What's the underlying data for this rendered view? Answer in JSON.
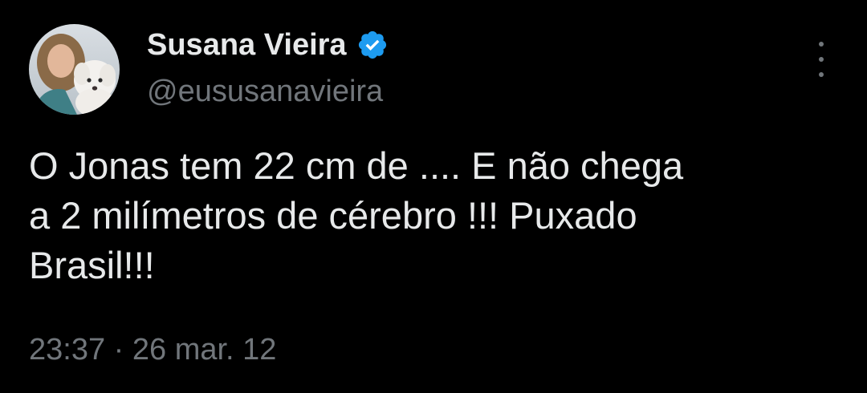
{
  "tweet": {
    "author": {
      "display_name": "Susana Vieira",
      "handle": "@eususanavieira",
      "verified": true,
      "verified_icon": "verified-badge-icon",
      "verified_color": "#1d9bf0"
    },
    "text": "O Jonas tem 22 cm de .... E não chega\na 2 milímetros de cérebro !!! Puxado\nBrasil!!!",
    "time": "23:37",
    "separator": " · ",
    "date": "26 mar. 12",
    "more_icon": "more-options-icon"
  },
  "colors": {
    "background": "#000000",
    "primary_text": "#e7e9ea",
    "secondary_text": "#71767b"
  }
}
